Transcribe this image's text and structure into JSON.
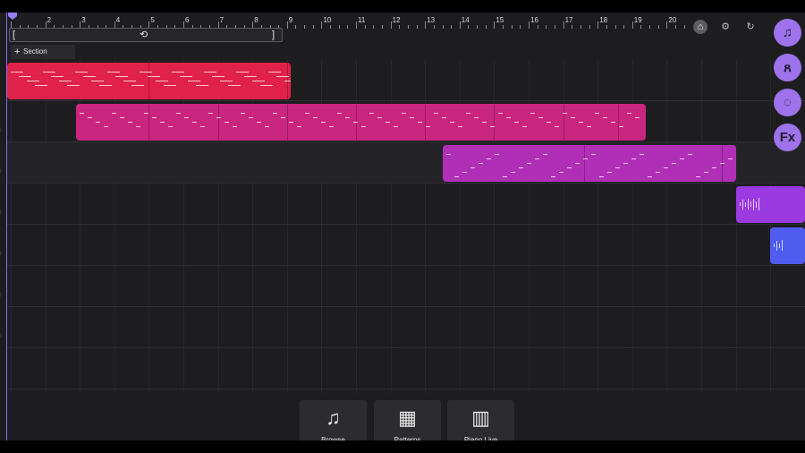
{
  "ruler": {
    "labels": [
      "2",
      "3",
      "4",
      "5",
      "6",
      "7",
      "8",
      "9",
      "10",
      "11",
      "12",
      "13",
      "14",
      "15",
      "16",
      "17",
      "18",
      "19",
      "20"
    ]
  },
  "toolbar": {
    "metronome_icon": "metronome-icon",
    "settings_icon": "gear-icon",
    "undo_icon": "undo-icon"
  },
  "loop": {
    "start_icon": "loop-start-bracket-icon",
    "toggle_icon": "loop-icon",
    "end_icon": "loop-end-bracket-icon"
  },
  "section": {
    "label": "Section",
    "icon": "plus-icon"
  },
  "side_panel": [
    {
      "name": "sounds-button",
      "icon": "music-note-icon",
      "glyph": "♫"
    },
    {
      "name": "collab-button",
      "icon": "users-icon",
      "glyph": "ጸ"
    },
    {
      "name": "chat-button",
      "icon": "chat-bubble-icon",
      "glyph": "◌"
    },
    {
      "name": "fx-button",
      "icon": "fx-icon",
      "glyph": "Fx"
    }
  ],
  "clips": [
    {
      "lane": 0,
      "color": "#e0214a",
      "start": 0.9,
      "end": 9.1,
      "segments": [
        0.9,
        5.0,
        9.0
      ]
    },
    {
      "lane": 1,
      "color": "#c9267f",
      "start": 2.9,
      "end": 19.4,
      "segments": [
        2.9,
        5.0,
        7.0,
        9.0,
        11.0,
        13.0,
        15.0,
        17.0,
        18.6
      ]
    },
    {
      "lane": 2,
      "color": "#b12fb6",
      "start": 13.5,
      "end": 22.0,
      "segments": [
        13.5,
        17.6,
        21.6
      ]
    },
    {
      "lane": 3,
      "color": "#9a3ae0",
      "start": 22.0,
      "end": 24.0,
      "segments": [
        22.0
      ]
    },
    {
      "lane": 4,
      "color": "#4f5cf0",
      "start": 23.0,
      "end": 24.0,
      "segments": [
        23.0
      ]
    }
  ],
  "dock": [
    {
      "name": "browse-button",
      "label": "Browse",
      "icon": "music-notes-icon",
      "glyph": "♫"
    },
    {
      "name": "patterns-button",
      "label": "Patterns",
      "icon": "grid-icon",
      "glyph": "▦"
    },
    {
      "name": "pianolive-button",
      "label": "Piano Live",
      "icon": "piano-icon",
      "glyph": "▥"
    }
  ]
}
